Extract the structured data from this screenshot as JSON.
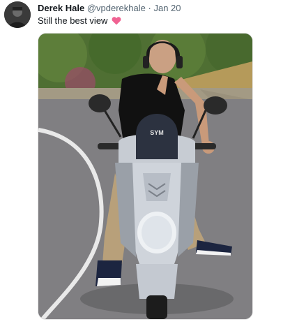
{
  "tweet": {
    "author_name": "Derek Hale",
    "handle": "@vpderekhale",
    "separator": "·",
    "date": "Jan 20",
    "text": "Still the best view",
    "emoji": "pink-heart-icon"
  },
  "media": {
    "scooter_brand": "SYM"
  },
  "colors": {
    "heart": "#f06292",
    "secondary_text": "#536471",
    "primary_text": "#0f1419"
  }
}
